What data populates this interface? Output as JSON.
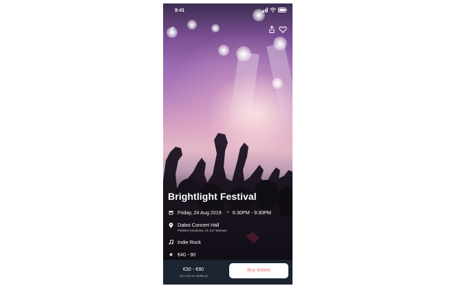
{
  "status_bar": {
    "time": "9:41"
  },
  "event": {
    "title": "Brightlight Festival",
    "date": "Friday, 24 Aug 2019",
    "time_range": "6:30PM - 9:30PM",
    "venue_name": "Daboi Concert Hall",
    "venue_address": "Pulaska Gniadowa, 01-217 Warsaw",
    "genre": "Indie Rock",
    "price_range_row": "€40 - 90"
  },
  "footer": {
    "price": "€30 - €80",
    "price_note": "Get now on skillet.pl",
    "buy_label": "Buy tickets"
  },
  "icons": {
    "back": "back-icon",
    "share": "share-icon",
    "favorite": "heart-icon",
    "calendar": "calendar-icon",
    "location": "location-pin-icon",
    "music": "music-note-icon",
    "ticket": "ticket-icon"
  },
  "colors": {
    "footer_bg": "#1b2430",
    "buy_text": "#e86b6b"
  }
}
